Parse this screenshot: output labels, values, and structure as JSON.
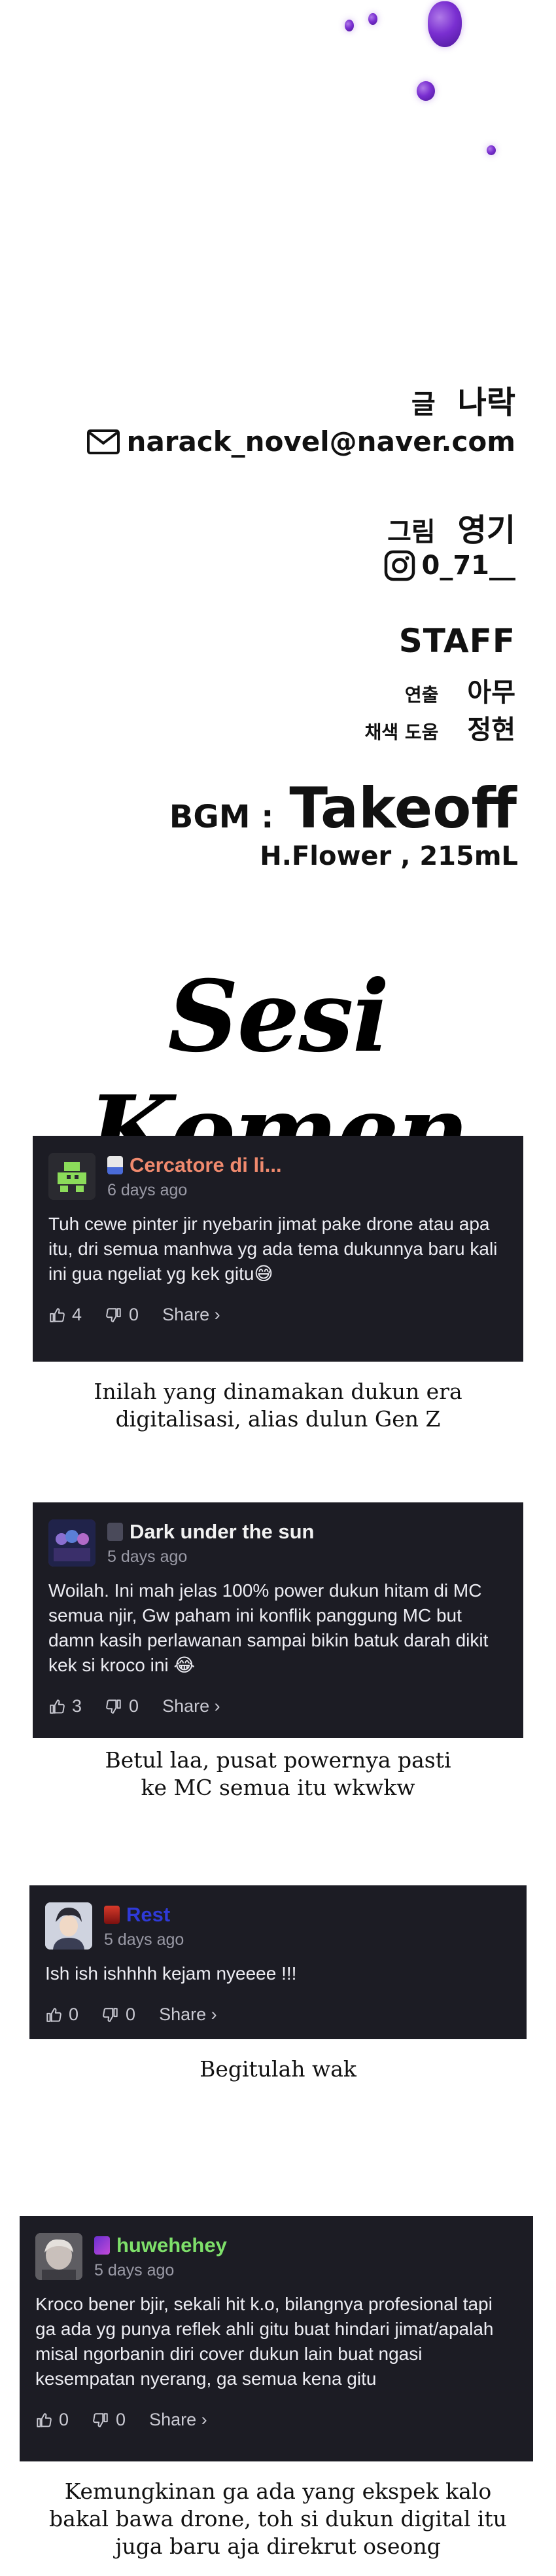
{
  "credits": {
    "writer_label": "글",
    "writer_name": "나락",
    "email": "narack_novel@naver.com",
    "artist_label": "그림",
    "artist_name": "영기",
    "instagram": "0_71__",
    "staff_title": "STAFF",
    "staff": [
      {
        "role": "연출",
        "name": "아무"
      },
      {
        "role": "채색 도움",
        "name": "정현"
      }
    ],
    "bgm_label": "BGM :",
    "bgm_title": "Takeoff",
    "bgm_artist": "H.Flower , 215mL"
  },
  "section_title": "Sesi Komen",
  "comments": [
    {
      "username": "Cercatore di li...",
      "username_color": "#f08a6e",
      "time": "6 days ago",
      "text": "Tuh cewe pinter jir nyebarin jimat pake drone atau apa itu, dri semua manhwa yg ada tema dukunnya baru kali ini gua ngeliat yg kek gitu😅",
      "likes": "4",
      "dislikes": "0",
      "share": "Share ›",
      "caption": [
        "Inilah yang dinamakan dukun era",
        "digitalisasi, alias dulun Gen Z"
      ]
    },
    {
      "username": "Dark under the sun",
      "username_color": "#f2f2f2",
      "time": "5 days ago",
      "text": "Woilah. Ini mah jelas 100% power dukun hitam di MC semua njir, Gw paham ini konflik panggung MC but damn kasih perlawanan sampai bikin batuk darah dikit kek si kroco ini 😂",
      "likes": "3",
      "dislikes": "0",
      "share": "Share ›",
      "caption": [
        "Betul laa, pusat powernya pasti",
        "ke MC semua itu wkwkw"
      ]
    },
    {
      "username": "Rest",
      "username_color": "#2f3ad8",
      "time": "5 days ago",
      "text": "Ish ish ishhhh kejam nyeeee !!!",
      "likes": "0",
      "dislikes": "0",
      "share": "Share ›",
      "caption": [
        "Begitulah wak"
      ]
    },
    {
      "username": "huwehehey",
      "username_color": "#7ee06a",
      "time": "5 days ago",
      "text": "Kroco bener bjir, sekali hit k.o, bilangnya profesional tapi ga ada yg punya reflek ahli gitu buat hindari jimat/apalah misal ngorbanin diri cover dukun lain buat ngasi kesempatan nyerang, ga semua kena gitu",
      "likes": "0",
      "dislikes": "0",
      "share": "Share ›",
      "caption": [
        "Kemungkinan ga ada yang ekspek kalo",
        "bakal bawa drone, toh si dukun digital itu",
        "juga baru aja direkrut oseong"
      ]
    }
  ],
  "colors": {
    "card_bg": "#1c1c24",
    "drop_purple": "#7a2fd1"
  }
}
